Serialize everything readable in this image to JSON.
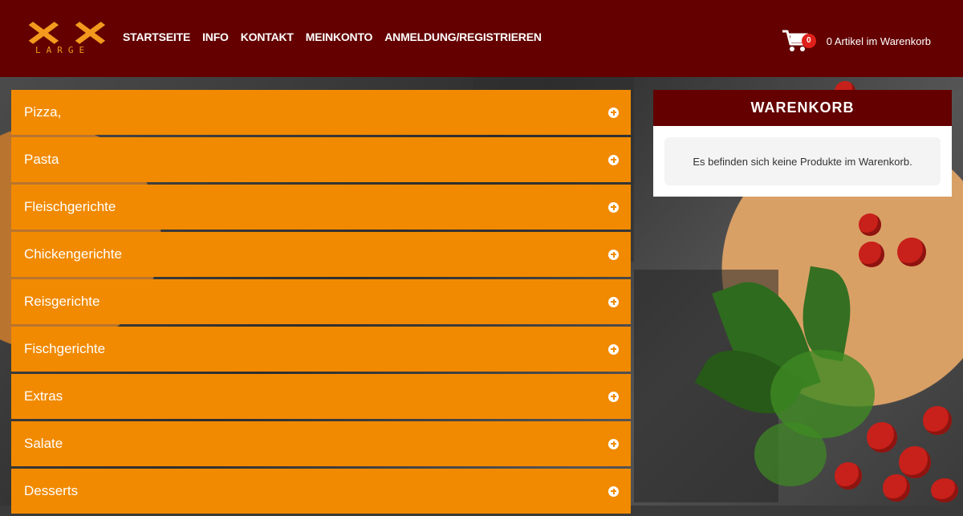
{
  "brand": {
    "logo_text": "XX",
    "logo_sub": "LARGE"
  },
  "nav": {
    "items": [
      "STARTSEITE",
      "INFO",
      "KONTAKT",
      "MEINKONTO",
      "ANMELDUNG/REGISTRIEREN"
    ]
  },
  "header_cart": {
    "count": "0",
    "label": "0 Artikel im Warenkorb"
  },
  "categories": [
    "Pizza,",
    "Pasta",
    "Fleischgerichte",
    "Chickengerichte",
    "Reisgerichte",
    "Fischgerichte",
    "Extras",
    "Salate",
    "Desserts"
  ],
  "cart_panel": {
    "title": "WARENKORB",
    "empty_message": "Es befinden sich keine Produkte im Warenkorb."
  },
  "colors": {
    "header": "#640000",
    "accent": "#f18a00",
    "logo": "#f39a1e"
  },
  "icons": {
    "cart": "shopping-cart-icon",
    "expand": "plus-circle-icon"
  }
}
